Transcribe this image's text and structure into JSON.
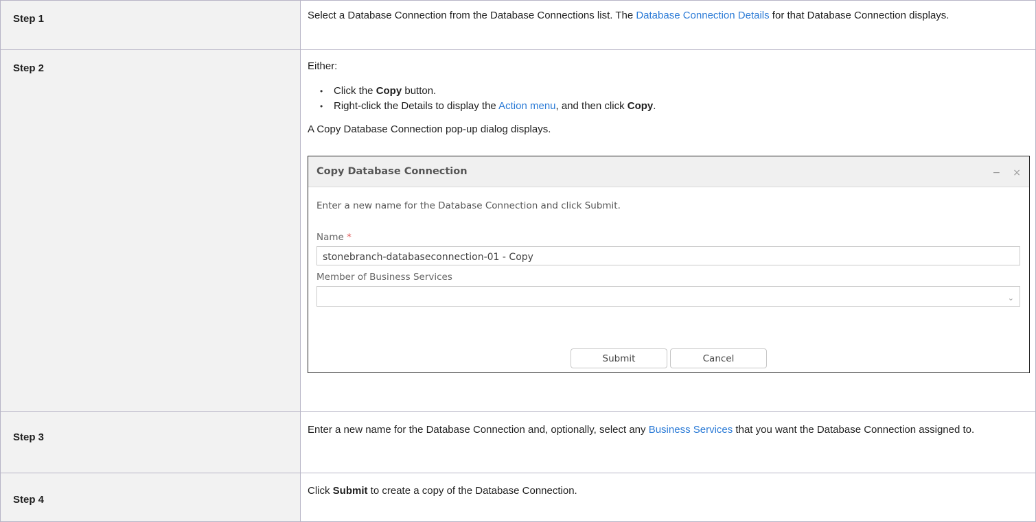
{
  "steps": [
    {
      "label": "Step 1",
      "text_before": "Select a Database Connection from the Database Connections list. The ",
      "link": "Database Connection Details",
      "text_after": " for that Database Connection displays."
    },
    {
      "label": "Step 2",
      "intro": "Either:",
      "bullet1_before": "Click the ",
      "bullet1_bold": "Copy",
      "bullet1_after": " button.",
      "bullet2_before": "Right-click the Details to display the ",
      "bullet2_link": "Action menu",
      "bullet2_mid": ", and then click ",
      "bullet2_bold": "Copy",
      "bullet2_after": ".",
      "outro": "A Copy Database Connection pop-up dialog displays."
    },
    {
      "label": "Step 3",
      "text_before": "Enter a new name for the Database Connection and, optionally, select any ",
      "link": "Business Services",
      "text_after": " that you want the Database Connection assigned to."
    },
    {
      "label": "Step 4",
      "text_before": "Click ",
      "bold": "Submit",
      "text_after": " to create a copy of the Database Connection."
    }
  ],
  "dialog": {
    "title": "Copy Database Connection",
    "minimize": "−",
    "close": "×",
    "instruction": "Enter a new name for the Database Connection and click Submit.",
    "name_label": "Name",
    "required_mark": "*",
    "name_value": "stonebranch-databaseconnection-01 - Copy",
    "member_label": "Member of Business Services",
    "member_value": "",
    "chevron": "⌵",
    "submit_label": "Submit",
    "cancel_label": "Cancel"
  }
}
